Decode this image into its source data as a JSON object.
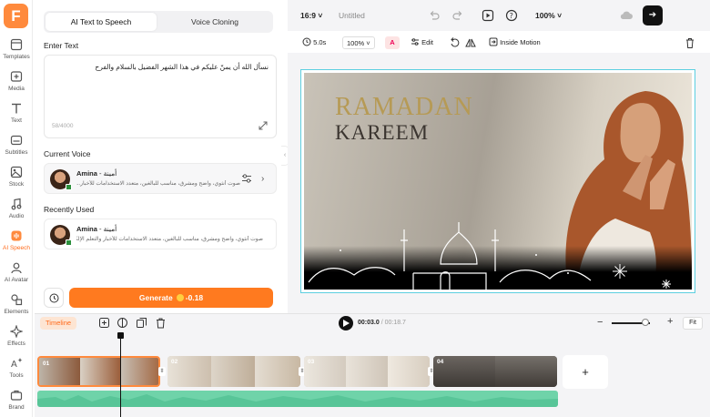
{
  "app": {
    "logo_letter": "F"
  },
  "rail": [
    {
      "label": "Templates",
      "icon": "templates-icon"
    },
    {
      "label": "Media",
      "icon": "media-icon"
    },
    {
      "label": "Text",
      "icon": "text-icon"
    },
    {
      "label": "Subtitles",
      "icon": "subtitles-icon"
    },
    {
      "label": "Stock",
      "icon": "stock-icon"
    },
    {
      "label": "Audio",
      "icon": "audio-icon"
    },
    {
      "label": "AI Speech",
      "icon": "ai-speech-icon",
      "active": true
    },
    {
      "label": "AI Avatar",
      "icon": "ai-avatar-icon"
    },
    {
      "label": "Elements",
      "icon": "elements-icon"
    },
    {
      "label": "Effects",
      "icon": "effects-icon"
    },
    {
      "label": "Tools",
      "icon": "tools-icon"
    },
    {
      "label": "Brand",
      "icon": "brand-icon"
    }
  ],
  "panel": {
    "tabs": {
      "active": "AI Text to Speech",
      "other": "Voice Cloning"
    },
    "enter_text_title": "Enter Text",
    "text_value": "نسأل الله أن يمنّ عليكم في هذا الشهر الفضيل بالسلام والفرح",
    "char_count": "58/4000",
    "current_voice_title": "Current Voice",
    "recently_used_title": "Recently Used",
    "current_voice": {
      "name": "Amina",
      "name_ar": "- أمينة",
      "desc": "صوت أنثوي، واضح ومشرق، مناسب للبالغين، متعدد الاستخدامات للأخبار..."
    },
    "recent_voice": {
      "name": "Amina",
      "name_ar": "- أمينة",
      "desc": "صوت أنثوي، واضح ومشرق، مناسب للبالغين، متعدد الاستخدامات للأخبار والتعلم الإلكتروني..."
    },
    "generate_label": "Generate",
    "generate_cost": "-0.18"
  },
  "topbar": {
    "ratio": "16:9",
    "title": "Untitled",
    "zoom": "100%"
  },
  "toolbar2": {
    "duration": "5.0s",
    "scale": "100%",
    "edit": "Edit",
    "inside_motion": "Inside Motion"
  },
  "canvas": {
    "line1": "RAMADAN",
    "line2": "KAREEM"
  },
  "timeline": {
    "badge": "Timeline",
    "current_time": "00:03.0",
    "total_time": "/ 00:18.7",
    "fit_label": "Fit",
    "add_label": "+",
    "clips": [
      "01",
      "02",
      "03",
      "04"
    ]
  },
  "colors": {
    "accent": "#ff7a1f",
    "selection": "#5ccfe0",
    "audio": "#6fd3a9"
  }
}
